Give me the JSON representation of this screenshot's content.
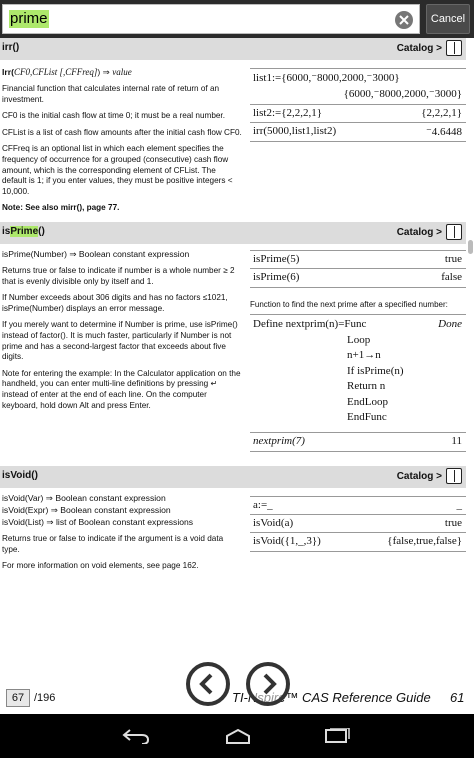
{
  "search": {
    "query": "prime",
    "cancel_label": "Cancel"
  },
  "catalog_label": "Catalog >",
  "irr": {
    "title": "irr()",
    "syntax_fn": "Irr(",
    "syntax_args": "CF0,CFList [,CFFreq]",
    "syntax_close": ")",
    "syntax_result": "value",
    "desc": "Financial function that calculates internal rate of return of an investment.",
    "cf0": "CF0 is the initial cash flow at time 0; it must be a real number.",
    "cflist": "CFList is a list of cash flow amounts after the initial cash flow CF0.",
    "cffreq": "CFFreq is an optional list in which each element specifies the frequency of occurrence for a grouped (consecutive) cash flow amount, which is the corresponding element of CFList. The default is 1; if you enter values, they must be positive integers < 10,000.",
    "note": "Note: See also mirr(), page 77.",
    "rows": [
      {
        "input": "list1:={6000,⁻8000,2000,⁻3000}",
        "output": "{6000,⁻8000,2000,⁻3000}"
      },
      {
        "input": "list2:={2,2,2,1}",
        "output": "{2,2,2,1}"
      },
      {
        "input": "irr(5000,list1,list2)",
        "output": "⁻4.6448"
      }
    ]
  },
  "isprime": {
    "title_pre": "is",
    "title_hl": "Prime",
    "title_post": "()",
    "syntax": "isPrime(Number) ⇒ Boolean constant expression",
    "desc": "Returns true or false to indicate if number is a whole number ≥ 2 that is evenly divisible only by itself and 1.",
    "limit": "If Number exceeds about 306 digits and has no factors ≤1021, isPrime(Number) displays an error message.",
    "merely": "If you merely want to determine if Number is prime, use isPrime() instead of factor(). It is much faster, particularly if Number is not prime and has a second-largest factor that exceeds about five digits.",
    "note_example": "Note for entering the example: In the Calculator application on the handheld, you can enter multi-line definitions by pressing ↵ instead of enter at the end of each line. On the computer keyboard, hold down Alt and press Enter.",
    "rows": [
      {
        "input": "isPrime(5)",
        "output": "true"
      },
      {
        "input": "isPrime(6)",
        "output": "false"
      }
    ],
    "func_caption": "Function to find the next prime after a specified number:",
    "def_lines": [
      "Define nextprim(n)=Func",
      "Loop",
      "n+1→n",
      "If isPrime(n)",
      "Return n",
      "EndLoop",
      "EndFunc"
    ],
    "def_done": "Done",
    "call": {
      "input": "nextprim(7)",
      "output": "11"
    }
  },
  "isvoid": {
    "title": "isVoid()",
    "syntax": [
      "isVoid(Var) ⇒ Boolean constant expression",
      "isVoid(Expr) ⇒ Boolean constant expression",
      "isVoid(List) ⇒ list of Boolean constant expressions"
    ],
    "desc": "Returns true or false to indicate if the argument is a void data type.",
    "more": "For more information on void elements, see page 162.",
    "rows": [
      {
        "input": "a:=_",
        "output": "_"
      },
      {
        "input": "isVoid(a)",
        "output": "true"
      },
      {
        "input": "isVoid({1,_,3})",
        "output": "{false,true,false}"
      }
    ]
  },
  "footer": {
    "page_current": "67",
    "page_total": "/196",
    "guide_title": "TI-Nspire™ CAS Reference Guide",
    "page_number": "61"
  }
}
